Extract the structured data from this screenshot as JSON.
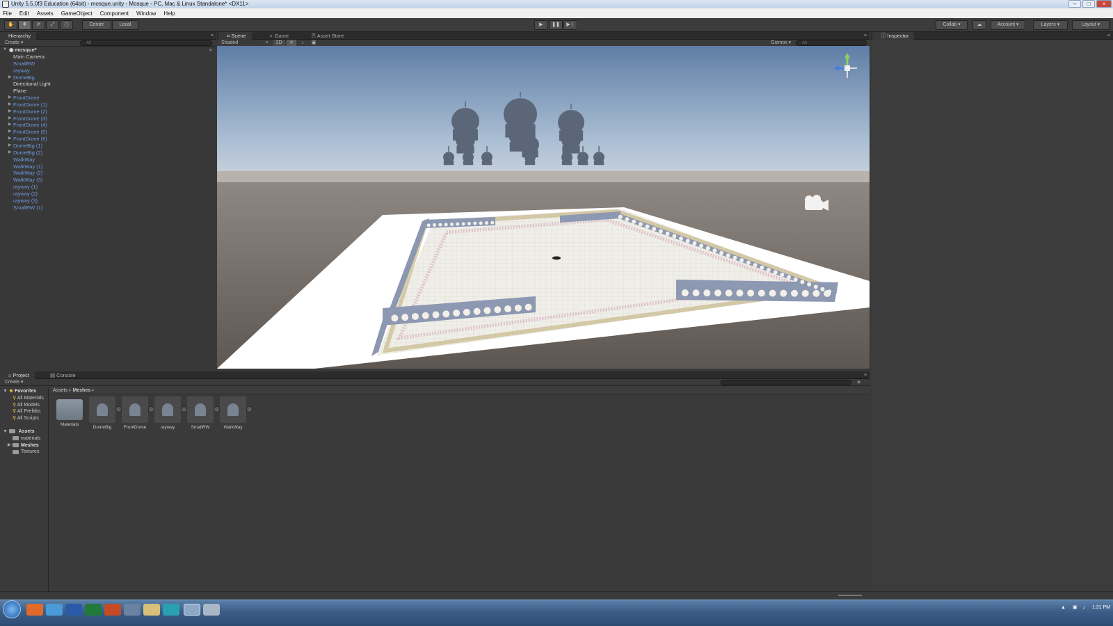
{
  "window": {
    "title": "Unity 5.5.0f3 Education (64bit) - mosque.unity - Mosque - PC, Mac & Linux Standalone* <DX11>"
  },
  "menu": [
    "File",
    "Edit",
    "Assets",
    "GameObject",
    "Component",
    "Window",
    "Help"
  ],
  "toolbar": {
    "pivot_label": "Center",
    "space_label": "Local",
    "collab_label": "Collab",
    "account_label": "Account",
    "layers_label": "Layers",
    "layout_label": "Layout"
  },
  "hierarchy": {
    "tab": "Hierarchy",
    "create": "Create",
    "search": "All",
    "scene": "mosque*",
    "items": [
      {
        "label": "Main Camera",
        "prefab": false,
        "expand": false
      },
      {
        "label": "SmallRW",
        "prefab": true,
        "expand": false
      },
      {
        "label": "rayway",
        "prefab": true,
        "expand": false
      },
      {
        "label": "DomeBig",
        "prefab": true,
        "expand": true
      },
      {
        "label": "Directional Light",
        "prefab": false,
        "expand": false
      },
      {
        "label": "Plane",
        "prefab": false,
        "expand": false
      },
      {
        "label": "FrontDome",
        "prefab": true,
        "expand": true
      },
      {
        "label": "FrontDome (1)",
        "prefab": true,
        "expand": true
      },
      {
        "label": "FrontDome (2)",
        "prefab": true,
        "expand": true
      },
      {
        "label": "FrontDome (3)",
        "prefab": true,
        "expand": true
      },
      {
        "label": "FrontDome (4)",
        "prefab": true,
        "expand": true
      },
      {
        "label": "FrontDome (5)",
        "prefab": true,
        "expand": true
      },
      {
        "label": "FrontDome (6)",
        "prefab": true,
        "expand": true
      },
      {
        "label": "DomeBig (1)",
        "prefab": true,
        "expand": true
      },
      {
        "label": "DomeBig (2)",
        "prefab": true,
        "expand": true
      },
      {
        "label": "WalkWay",
        "prefab": true,
        "expand": false
      },
      {
        "label": "WalkWay (1)",
        "prefab": true,
        "expand": false
      },
      {
        "label": "WalkWay (2)",
        "prefab": true,
        "expand": false
      },
      {
        "label": "WalkWay (3)",
        "prefab": true,
        "expand": false
      },
      {
        "label": "rayway (1)",
        "prefab": true,
        "expand": false
      },
      {
        "label": "rayway (2)",
        "prefab": true,
        "expand": false
      },
      {
        "label": "rayway (3)",
        "prefab": true,
        "expand": false
      },
      {
        "label": "SmallRW (1)",
        "prefab": true,
        "expand": false
      }
    ]
  },
  "scene": {
    "tabs": [
      "Scene",
      "Game",
      "Asset Store"
    ],
    "shading": "Shaded",
    "mode_2d": "2D",
    "gizmos": "Gizmos",
    "search": "All"
  },
  "inspector": {
    "tab": "Inspector"
  },
  "project": {
    "tabs": [
      "Project",
      "Console"
    ],
    "create": "Create",
    "breadcrumb": [
      "Assets",
      "Meshes"
    ],
    "favorites_label": "Favorites",
    "favorites": [
      "All Materials",
      "All Models",
      "All Prefabs",
      "All Scripts"
    ],
    "assets_label": "Assets",
    "folders": [
      "materials",
      "Meshes",
      "Textures"
    ],
    "items": [
      {
        "label": "Materials",
        "kind": "folder"
      },
      {
        "label": "DomeBig",
        "kind": "model"
      },
      {
        "label": "FrontDome",
        "kind": "model"
      },
      {
        "label": "rayway",
        "kind": "model"
      },
      {
        "label": "SmallRW",
        "kind": "model"
      },
      {
        "label": "WalkWay",
        "kind": "model"
      }
    ]
  },
  "taskbar": {
    "clock": "1:31 PM"
  }
}
